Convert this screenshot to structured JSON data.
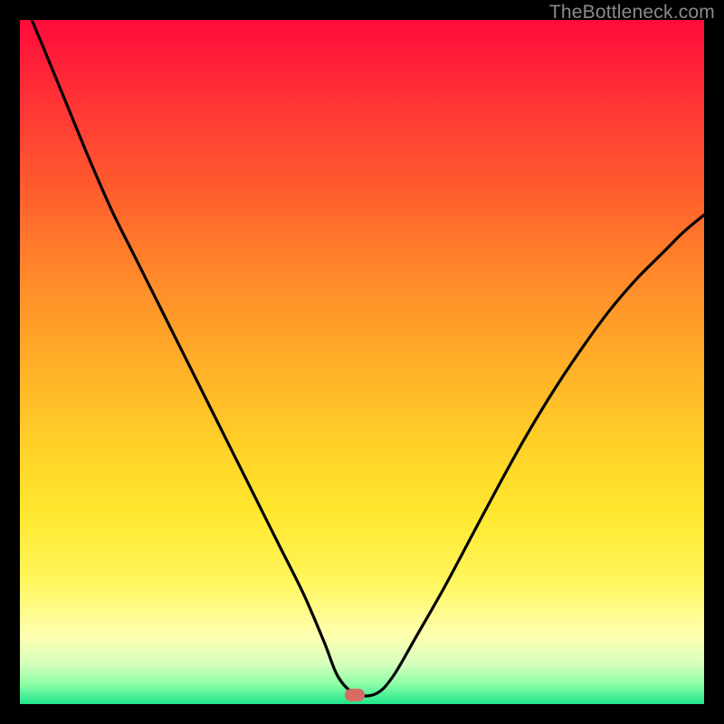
{
  "watermark": "TheBottleneck.com",
  "marker": {
    "cx_frac": 0.489,
    "cy_frac": 0.987,
    "color": "#d96b63"
  },
  "chart_data": {
    "type": "line",
    "title": "",
    "xlabel": "",
    "ylabel": "",
    "xlim": [
      0,
      1
    ],
    "ylim": [
      0,
      1
    ],
    "series": [
      {
        "name": "bottleneck-curve",
        "x": [
          0.0,
          0.03,
          0.065,
          0.1,
          0.135,
          0.17,
          0.205,
          0.24,
          0.275,
          0.31,
          0.345,
          0.38,
          0.415,
          0.445,
          0.465,
          0.49,
          0.52,
          0.545,
          0.58,
          0.62,
          0.66,
          0.7,
          0.74,
          0.78,
          0.82,
          0.86,
          0.9,
          0.94,
          0.97,
          1.0
        ],
        "values": [
          1.04,
          0.97,
          0.885,
          0.8,
          0.72,
          0.65,
          0.58,
          0.51,
          0.44,
          0.37,
          0.3,
          0.23,
          0.16,
          0.09,
          0.04,
          0.015,
          0.015,
          0.04,
          0.1,
          0.17,
          0.245,
          0.32,
          0.392,
          0.458,
          0.518,
          0.573,
          0.62,
          0.66,
          0.69,
          0.715
        ]
      }
    ],
    "minimum_at_x": 0.49,
    "background": "red-yellow-green vertical gradient (high=red, low=green)"
  }
}
